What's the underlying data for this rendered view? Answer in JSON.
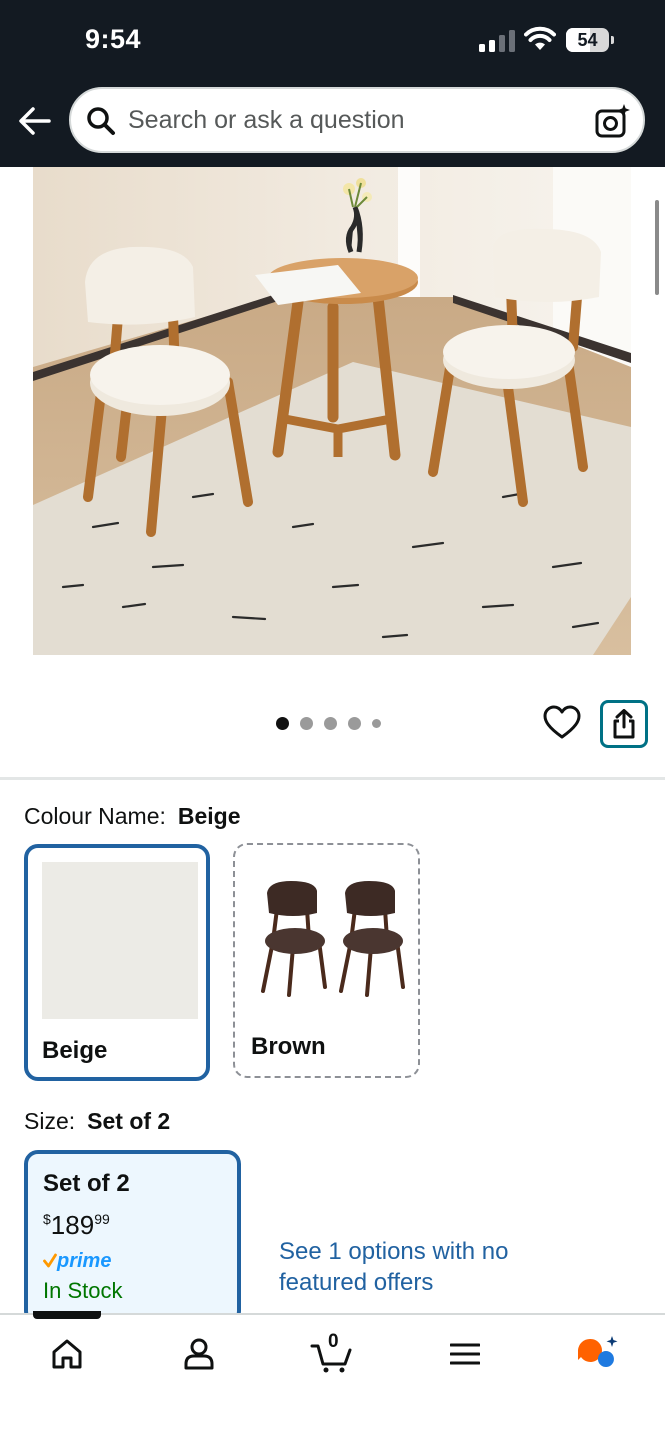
{
  "status_bar": {
    "time": "9:54",
    "battery": "54"
  },
  "search": {
    "placeholder": "Search or ask a question"
  },
  "gallery": {
    "image_count": 5,
    "active_index": 0
  },
  "colour": {
    "label": "Colour Name:",
    "selected": "Beige",
    "options": [
      {
        "name": "Beige",
        "state": "selected"
      },
      {
        "name": "Brown",
        "state": "unavailable"
      }
    ]
  },
  "size": {
    "label": "Size:",
    "selected": "Set of 2",
    "option": {
      "name": "Set of 2",
      "price_symbol": "$",
      "price_whole": "189",
      "price_fraction": "99",
      "prime_label": "prime",
      "availability": "In Stock"
    },
    "other_offers_link": "See 1 options with no featured offers"
  },
  "bottom_nav": {
    "cart_count": "0",
    "items": [
      "home-icon",
      "account-icon",
      "cart-icon",
      "menu-icon",
      "rufus-assistant-icon"
    ]
  },
  "colors": {
    "header_bg": "#131a22",
    "link_blue": "#2162a1",
    "share_teal": "#007185",
    "in_stock_green": "#007600",
    "prime_blue": "#1a98ff",
    "prime_check_orange": "#ff9900",
    "selected_card_bg": "#edf7fe"
  }
}
